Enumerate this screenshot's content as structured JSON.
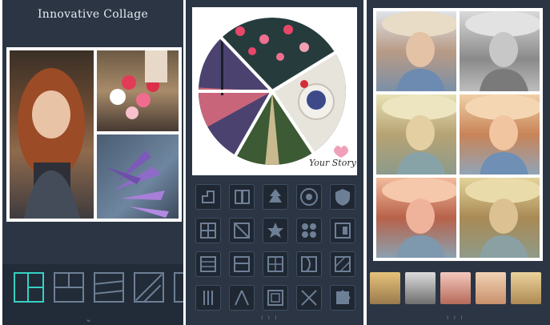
{
  "app": {
    "title": "Innovative Collage",
    "accent": "#36d1c3"
  },
  "collage_preview": {
    "tag_text": "Your Story"
  },
  "layouts": {
    "selected_index": 0,
    "count_visible": 5
  },
  "navigation": {
    "expand_icon": "chevron-down-icon",
    "pager_text": "ı ı ı"
  },
  "filters": {
    "count_visible": 5,
    "pager_text": "ı ı ı"
  }
}
